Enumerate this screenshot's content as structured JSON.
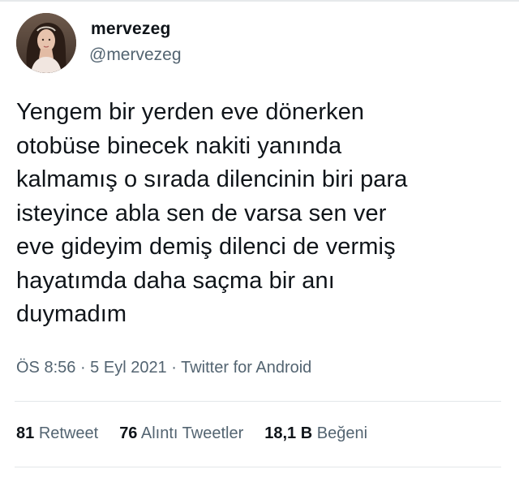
{
  "user": {
    "display_name": "mervezeg",
    "handle": "@mervezeg"
  },
  "tweet": {
    "text": "Yengem bir yerden eve dönerken\notobüse binecek nakiti yanında\nkalmamış o sırada dilencinin biri para\nisteyince abla sen de varsa sen ver\neve gideyim demiş dilenci de vermiş\nhayatımda daha saçma bir anı\nduymadım",
    "time": "ÖS 8:56",
    "date": "5 Eyl 2021",
    "source": "Twitter for Android",
    "separator": " · "
  },
  "stats": {
    "retweets_count": "81",
    "retweets_label": "Retweet",
    "quotes_count": "76",
    "quotes_label": "Alıntı Tweetler",
    "likes_count": "18,1 B",
    "likes_label": "Beğeni"
  },
  "icons": {
    "avatar": "profile-photo"
  },
  "colors": {
    "text_primary": "#0f1419",
    "text_secondary": "#536471",
    "divider": "#e3e7ea"
  }
}
